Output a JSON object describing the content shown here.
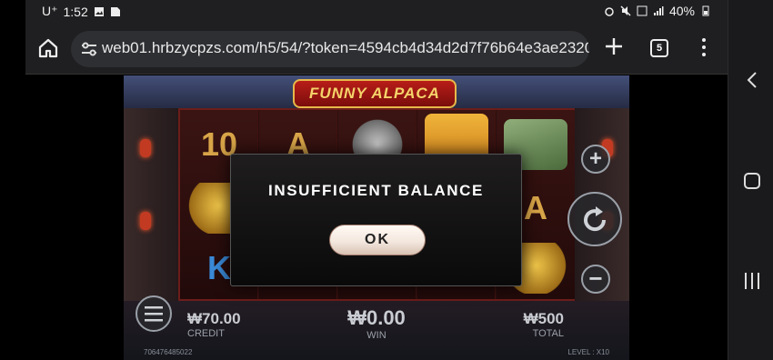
{
  "status_bar": {
    "carrier": "U⁺",
    "time": "1:52",
    "battery": "40%"
  },
  "browser": {
    "url": "web01.hrbzycpzs.com/h5/54/?token=4594cb4d34d2d7f76b64e3ae2320",
    "tab_count": "5"
  },
  "game": {
    "logo_text": "FUNNY ALPACA",
    "reel_symbols": [
      "10",
      "A",
      "A",
      "K",
      "K"
    ],
    "credit_value": "₩70.00",
    "credit_label": "CREDIT",
    "win_value": "₩0.00",
    "win_label": "WIN",
    "total_value": "₩500",
    "total_label": "TOTAL",
    "player_id": "706476485022",
    "level_text": "LEVEL : X10"
  },
  "dialog": {
    "message": "INSUFFICIENT BALANCE",
    "ok_label": "OK"
  }
}
